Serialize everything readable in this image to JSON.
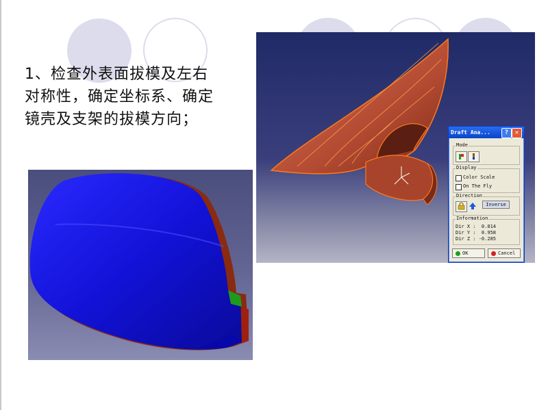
{
  "slide": {
    "headline_lines": [
      "1、检查外表面拔模及左右",
      "对称性，确定坐标系、确定",
      "镜壳及支架的拔模方向；"
    ]
  },
  "dialog": {
    "title": "Draft Ana...",
    "help_glyph": "?",
    "close_glyph": "✕",
    "mode_label": "Mode",
    "display_label": "Display",
    "color_scale_label": "Color Scale",
    "on_the_fly_label": "On The Fly",
    "direction_label": "Direction",
    "inverse_label": "Inverse",
    "information_label": "Information",
    "info_lines": [
      "Dir X :  0.014",
      "Dir Y :  0.958",
      "Dir Z : -0.285"
    ],
    "ok_label": "OK",
    "cancel_label": "Cancel"
  },
  "colors": {
    "circle": "#dcdcec",
    "mirror_blue": "#1a1ae6",
    "part_orange": "#c85a3c",
    "edge_orange": "#ff7a1a",
    "ok_green": "#1aa01a",
    "cancel_red": "#d62020"
  }
}
